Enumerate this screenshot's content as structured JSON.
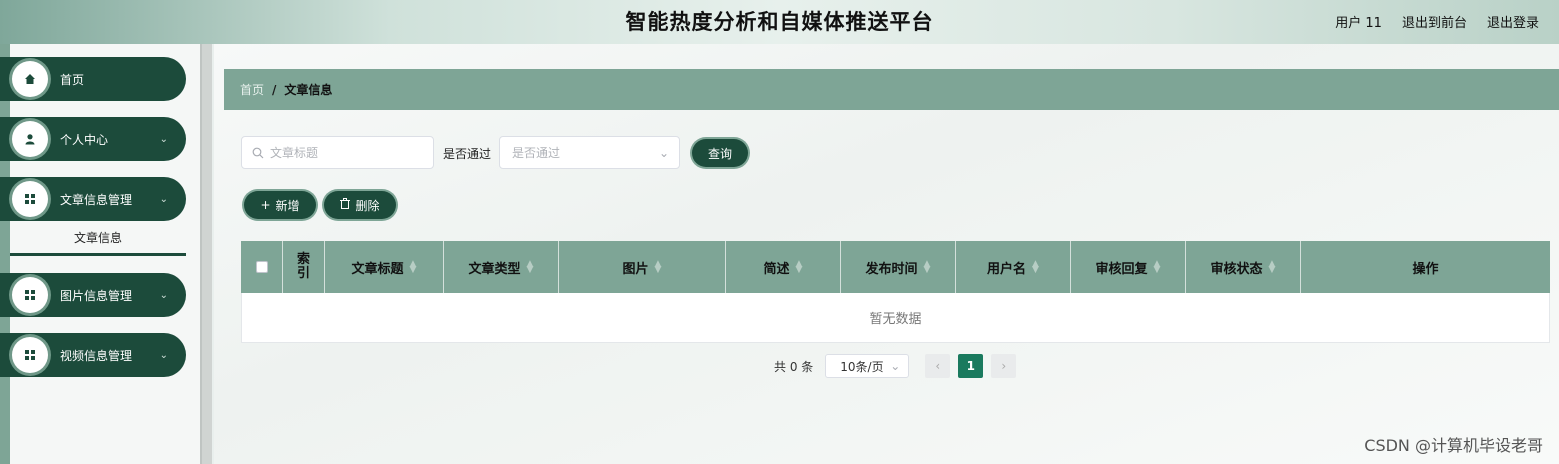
{
  "header": {
    "title": "智能热度分析和自媒体推送平台",
    "user": "用户 11",
    "to_front": "退出到前台",
    "logout": "退出登录"
  },
  "sidebar": {
    "items": [
      {
        "label": "首页",
        "icon": "home-icon"
      },
      {
        "label": "个人中心",
        "icon": "user-icon"
      },
      {
        "label": "文章信息管理",
        "icon": "grid-icon"
      },
      {
        "label": "图片信息管理",
        "icon": "grid-icon"
      },
      {
        "label": "视频信息管理",
        "icon": "grid-icon"
      }
    ],
    "submenu_active": "文章信息"
  },
  "breadcrumb": {
    "home": "首页",
    "separator": "/",
    "current": "文章信息"
  },
  "search": {
    "title_placeholder": "文章标题",
    "filter_label": "是否通过",
    "filter_placeholder": "是否通过",
    "query_label": "查询"
  },
  "actions": {
    "add_label": "新增",
    "delete_label": "删除"
  },
  "table": {
    "index_header_top": "索",
    "index_header_bottom": "引",
    "columns": [
      {
        "label": "文章标题",
        "sortable": true
      },
      {
        "label": "文章类型",
        "sortable": true
      },
      {
        "label": "图片",
        "sortable": true
      },
      {
        "label": "简述",
        "sortable": true
      },
      {
        "label": "发布时间",
        "sortable": true
      },
      {
        "label": "用户名",
        "sortable": true
      },
      {
        "label": "审核回复",
        "sortable": true
      },
      {
        "label": "审核状态",
        "sortable": true
      },
      {
        "label": "操作",
        "sortable": false
      }
    ],
    "empty_text": "暂无数据"
  },
  "pagination": {
    "total": "共 0 条",
    "page_size": "10条/页",
    "current_page": "1"
  },
  "watermark": "CSDN @计算机毕设老哥",
  "colors": {
    "primary_dark": "#1c4b3b",
    "accent": "#7ea596",
    "active_page": "#1a7a5e"
  }
}
